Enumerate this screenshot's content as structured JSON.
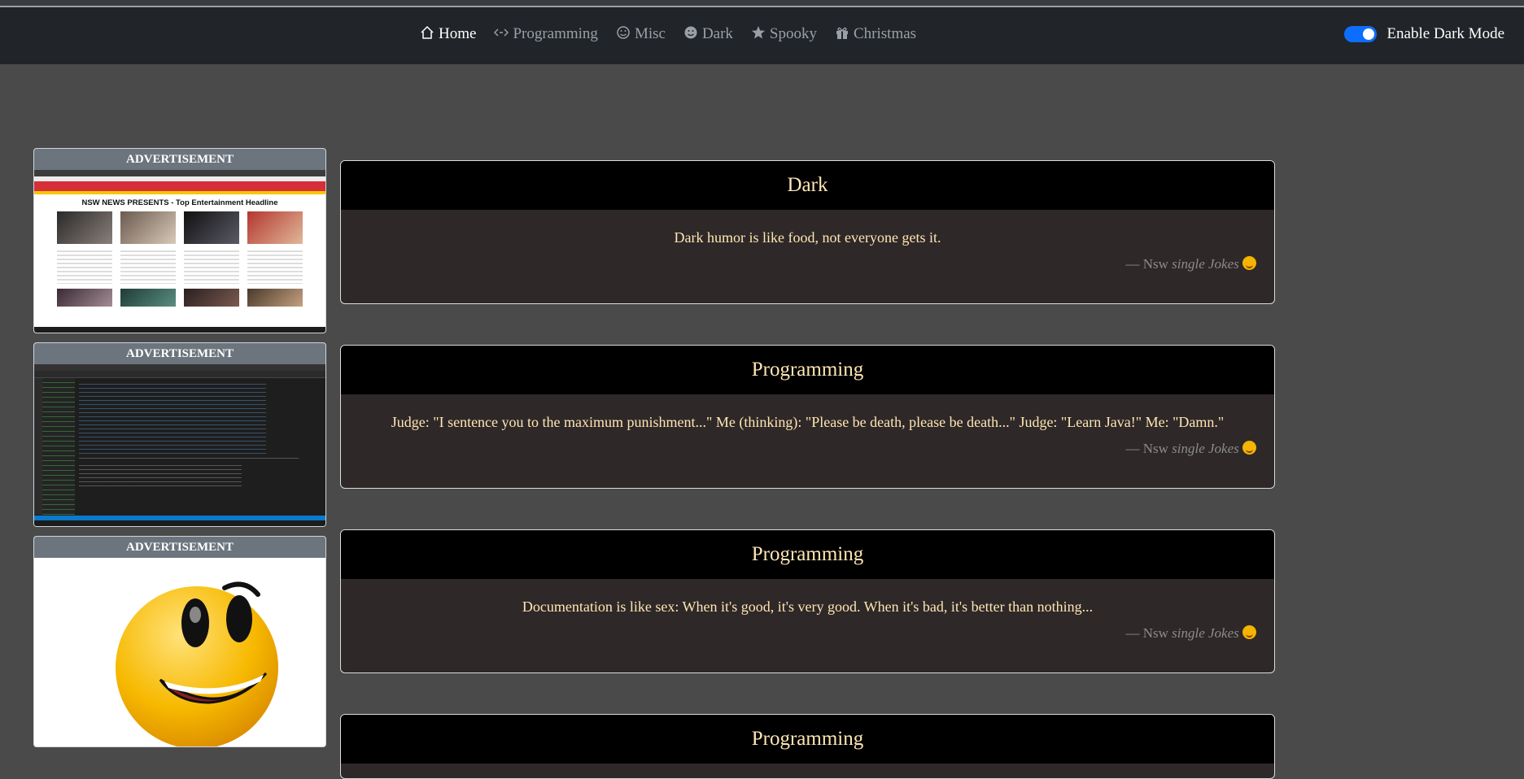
{
  "nav": {
    "items": [
      {
        "label": "Home",
        "icon": "home-icon",
        "active": true
      },
      {
        "label": "Programming",
        "icon": "code-icon",
        "active": false
      },
      {
        "label": "Misc",
        "icon": "smile-icon",
        "active": false
      },
      {
        "label": "Dark",
        "icon": "dark-face-icon",
        "active": false
      },
      {
        "label": "Spooky",
        "icon": "star-icon",
        "active": false
      },
      {
        "label": "Christmas",
        "icon": "gift-icon",
        "active": false
      }
    ],
    "dark_mode_label": "Enable Dark Mode",
    "dark_mode_enabled": true
  },
  "ads": [
    {
      "label": "ADVERTISEMENT",
      "headline": "NSW NEWS PRESENTS - Top Entertainment Headline"
    },
    {
      "label": "ADVERTISEMENT"
    },
    {
      "label": "ADVERTISEMENT"
    }
  ],
  "jokes": [
    {
      "category": "Dark",
      "text": "Dark humor is like food, not everyone gets it.",
      "author": "— Nsw",
      "source": "single Jokes"
    },
    {
      "category": "Programming",
      "text": "Judge: \"I sentence you to the maximum punishment...\" Me (thinking): \"Please be death, please be death...\" Judge: \"Learn Java!\" Me: \"Damn.\"",
      "author": "— Nsw",
      "source": "single Jokes"
    },
    {
      "category": "Programming",
      "text": "Documentation is like sex: When it's good, it's very good. When it's bad, it's better than nothing...",
      "author": "— Nsw",
      "source": "single Jokes"
    },
    {
      "category": "Programming"
    }
  ],
  "colors": {
    "accent": "#0d6efd",
    "card_header": "#000000",
    "card_text": "#ffe6b3",
    "page_bg": "#4a4a4a"
  }
}
